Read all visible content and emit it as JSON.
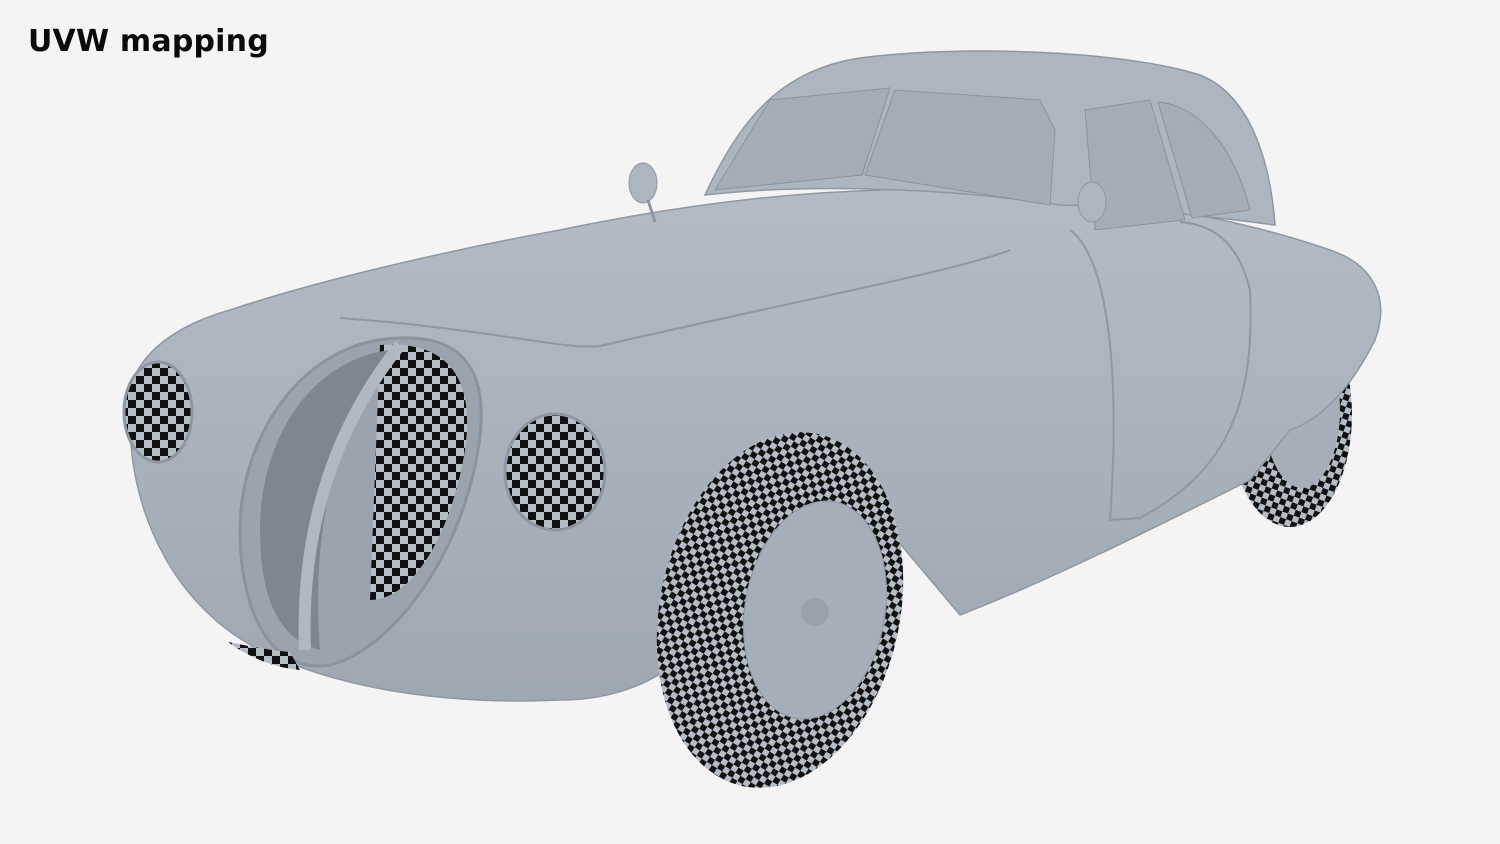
{
  "title": "UVW mapping",
  "colors": {
    "background": "#f4f4f4",
    "body": "#a8b0bb",
    "body_shadow": "#8f98a4",
    "checker_dark": "#111111",
    "checker_light": "#b4bcc6"
  }
}
